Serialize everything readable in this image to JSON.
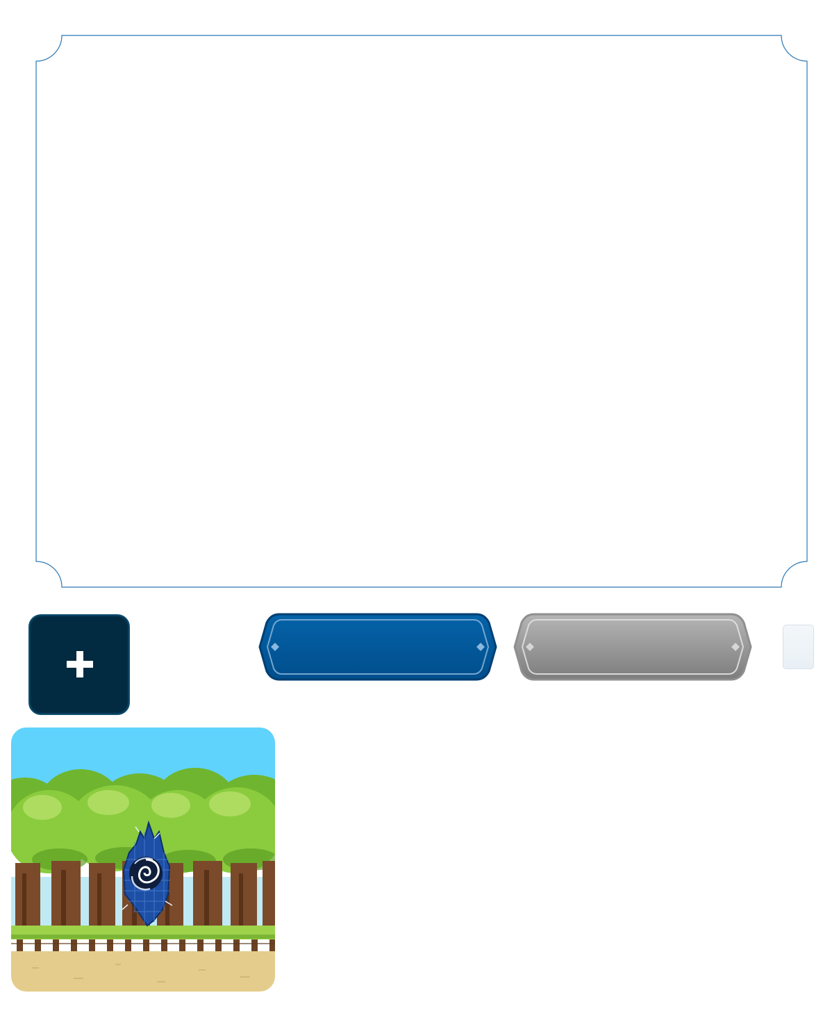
{
  "frame": {
    "border_color": "#2a78b4"
  },
  "add_button": {
    "icon": "plus-icon",
    "bg_color": "#022a40"
  },
  "primary_button": {
    "label": "",
    "color": "#005c9e"
  },
  "secondary_button": {
    "label": "",
    "color": "#9a9a9a"
  },
  "scene": {
    "sky_color": "#5fd3fb",
    "ground_color": "#e4cd8c",
    "portal_icon": "swirl-portal-icon",
    "tree_icon": "tree-icon"
  }
}
